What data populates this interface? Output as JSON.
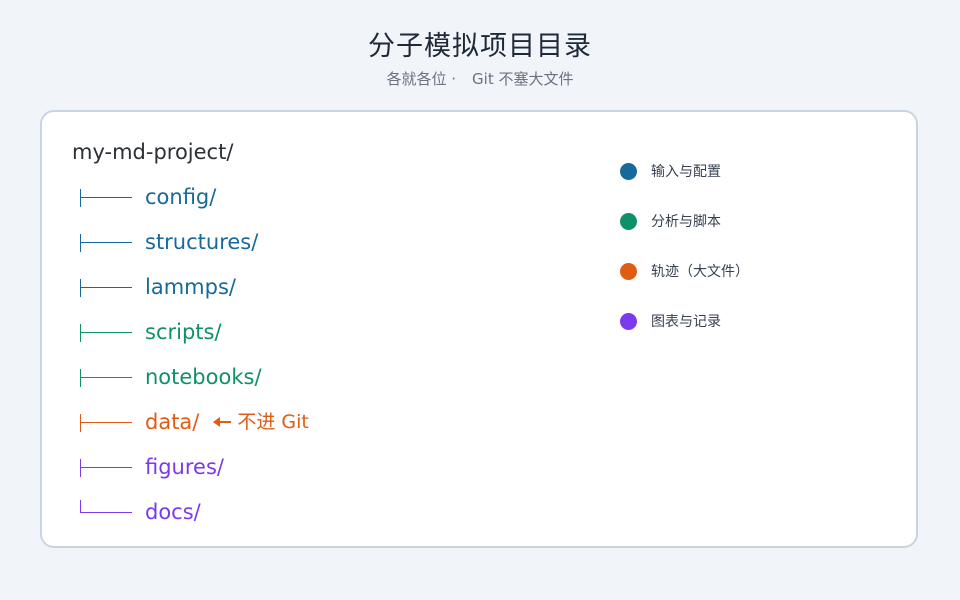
{
  "header": {
    "title": "分子模拟项目目录",
    "subtitle_left": "各就各位 ·",
    "subtitle_right": "Git 不塞大文件"
  },
  "colors": {
    "input": "#17699a",
    "analysis": "#0e9168",
    "trajectory": "#e05c14",
    "docs": "#7c3aed"
  },
  "tree": {
    "root": "my-md-project/",
    "items": [
      {
        "name": "config/",
        "category": "input"
      },
      {
        "name": "structures/",
        "category": "input"
      },
      {
        "name": "lammps/",
        "category": "input"
      },
      {
        "name": "scripts/",
        "category": "analysis"
      },
      {
        "name": "notebooks/",
        "category": "analysis"
      },
      {
        "name": "data/",
        "category": "trajectory",
        "note": "不进 Git"
      },
      {
        "name": "figures/",
        "category": "docs"
      },
      {
        "name": "docs/",
        "category": "docs"
      }
    ]
  },
  "legend": [
    {
      "label": "输入与配置",
      "category": "input"
    },
    {
      "label": "分析与脚本",
      "category": "analysis"
    },
    {
      "label": "轨迹（大文件）",
      "category": "trajectory"
    },
    {
      "label": "图表与记录",
      "category": "docs"
    }
  ]
}
